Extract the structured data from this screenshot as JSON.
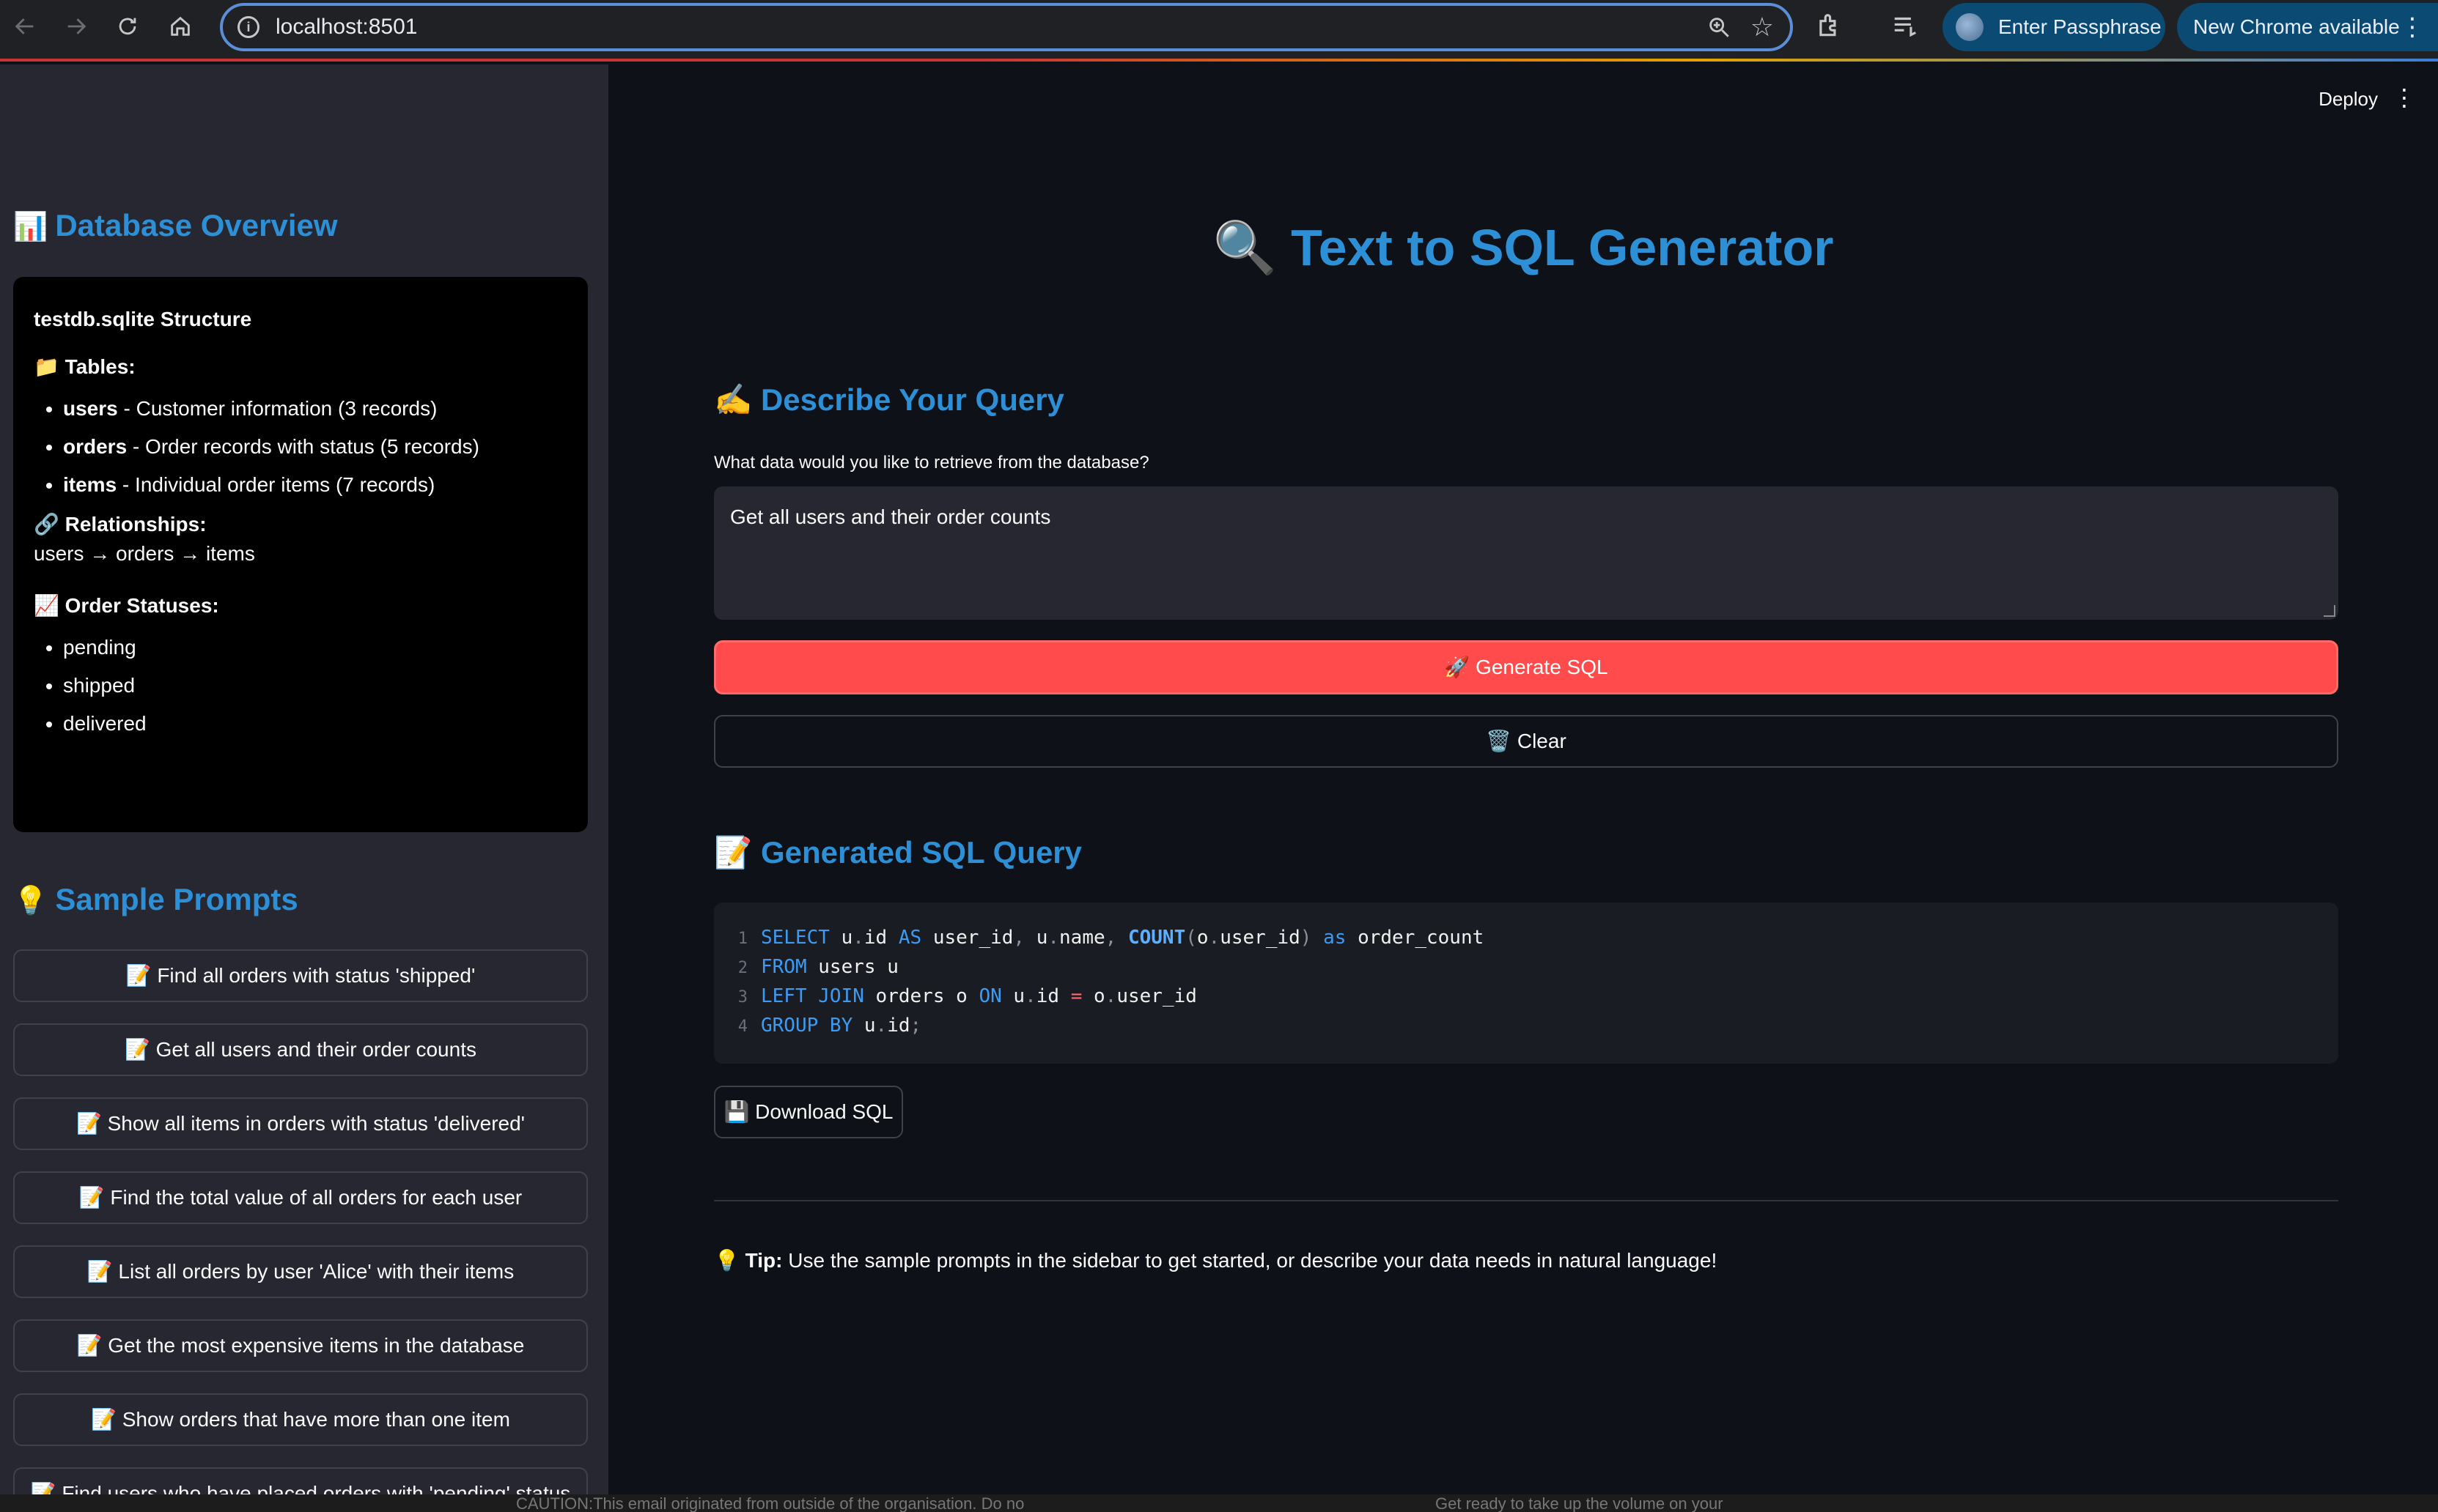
{
  "browser": {
    "url": "localhost:8501",
    "passphrase_label": "Enter Passphrase",
    "update_label": "New Chrome available"
  },
  "sidebar": {
    "db_heading": "Database Overview",
    "db_icon": "📊",
    "db_card": {
      "title": "testdb.sqlite Structure",
      "tables_label": "📁 Tables:",
      "tables": [
        {
          "name": "users",
          "desc": " - Customer information (3 records)"
        },
        {
          "name": "orders",
          "desc": " - Order records with status (5 records)"
        },
        {
          "name": "items",
          "desc": " - Individual order items (7 records)"
        }
      ],
      "relationships_label": "🔗 Relationships:",
      "relationships": "users → orders → items",
      "statuses_label": "📈 Order Statuses:",
      "statuses": [
        "pending",
        "shipped",
        "delivered"
      ]
    },
    "prompts_heading": "Sample Prompts",
    "prompts_icon": "💡",
    "prompts": [
      "📝 Find all orders with status 'shipped'",
      "📝 Get all users and their order counts",
      "📝 Show all items in orders with status 'delivered'",
      "📝 Find the total value of all orders for each user",
      "📝 List all orders by user 'Alice' with their items",
      "📝 Get the most expensive items in the database",
      "📝 Show orders that have more than one item",
      "📝 Find users who have placed orders with 'pending' status"
    ]
  },
  "main": {
    "deploy_label": "Deploy",
    "title": "🔍 Text to SQL Generator",
    "describe_heading": "✍️ Describe Your Query",
    "query_label": "What data would you like to retrieve from the database?",
    "query_value": "Get all users and their order counts",
    "generate_label": "🚀 Generate SQL",
    "clear_label": "🗑️ Clear",
    "sql_heading": "📝 Generated SQL Query",
    "sql_lines": [
      "SELECT u.id AS user_id, u.name, COUNT(o.user_id) as order_count",
      "FROM users u",
      "LEFT JOIN orders o ON u.id = o.user_id",
      "GROUP BY u.id;"
    ],
    "download_label": "💾 Download SQL",
    "tip_bold": "Tip:",
    "tip_icon": "💡",
    "tip_text": " Use the sample prompts in the sidebar to get started, or describe your data needs in natural language!"
  },
  "bottom_strip": {
    "left_text": "CAUTION:This email originated from outside of the organisation. Do no",
    "right_text": "Get ready to take up the volume on your"
  },
  "colors": {
    "accent": "#2d8fd5",
    "primary_button": "#ff4b4b",
    "background": "#0e1117",
    "sidebar": "#262730"
  }
}
